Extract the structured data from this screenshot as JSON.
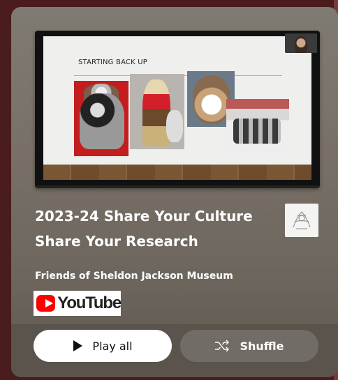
{
  "thumbnail": {
    "slide_title": "STARTING BACK UP"
  },
  "playlist": {
    "title_line1": "2023-24 Share Your Culture",
    "title_line2": "Share Your Research",
    "channel": "Friends of Sheldon Jackson Museum",
    "platform_logo_text": "YouTube"
  },
  "actions": {
    "play_all": "Play all",
    "shuffle": "Shuffle"
  },
  "icons": {
    "play_all": "play-icon",
    "shuffle": "shuffle-icon",
    "platform": "youtube-logo"
  },
  "colors": {
    "youtube_red": "#ff0000",
    "card_bg": "#7a736a",
    "page_bg": "#4a1c1e"
  }
}
